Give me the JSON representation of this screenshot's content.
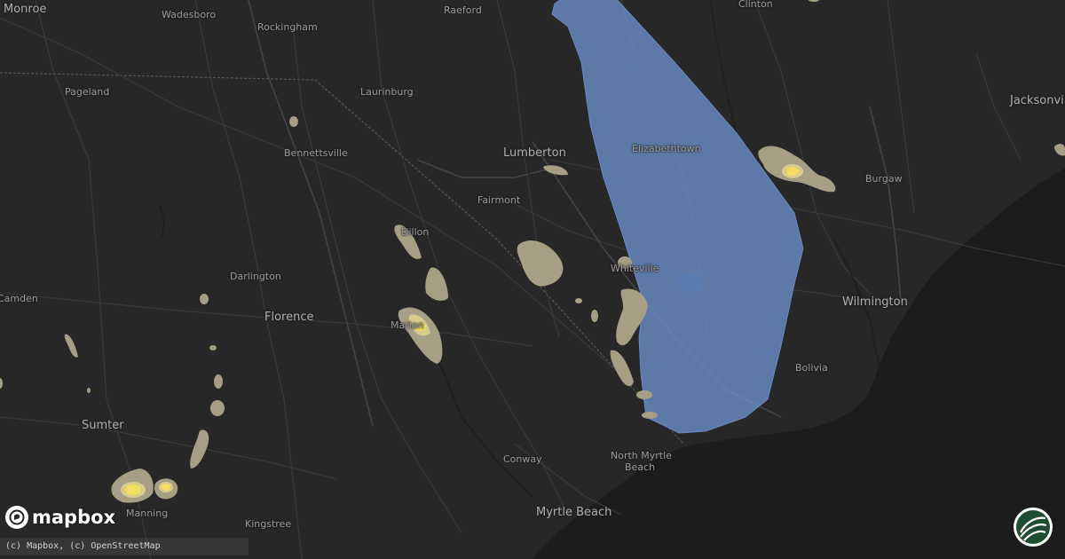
{
  "map": {
    "places": [
      {
        "id": "monroe",
        "name": "Monroe"
      },
      {
        "id": "wadesboro",
        "name": "Wadesboro"
      },
      {
        "id": "raeford",
        "name": "Raeford"
      },
      {
        "id": "clinton",
        "name": "Clinton"
      },
      {
        "id": "rockingham",
        "name": "Rockingham"
      },
      {
        "id": "pageland",
        "name": "Pageland"
      },
      {
        "id": "laurinburg",
        "name": "Laurinburg"
      },
      {
        "id": "jacksonville",
        "name": "Jacksonvil"
      },
      {
        "id": "bennettsville",
        "name": "Bennettsville"
      },
      {
        "id": "lumberton",
        "name": "Lumberton"
      },
      {
        "id": "elizabethtown",
        "name": "Elizabethtown"
      },
      {
        "id": "burgaw",
        "name": "Burgaw"
      },
      {
        "id": "fairmont",
        "name": "Fairmont"
      },
      {
        "id": "dillon",
        "name": "Dillon"
      },
      {
        "id": "whiteville",
        "name": "Whiteville"
      },
      {
        "id": "darlington",
        "name": "Darlington"
      },
      {
        "id": "camden",
        "name": "Camden"
      },
      {
        "id": "wilmington",
        "name": "Wilmington"
      },
      {
        "id": "florence",
        "name": "Florence"
      },
      {
        "id": "marion",
        "name": "Marion"
      },
      {
        "id": "bolivia",
        "name": "Bolivia"
      },
      {
        "id": "sumter",
        "name": "Sumter"
      },
      {
        "id": "conway",
        "name": "Conway"
      },
      {
        "id": "north-myrtle-beach-1",
        "name": "North Myrtle"
      },
      {
        "id": "north-myrtle-beach-2",
        "name": "Beach"
      },
      {
        "id": "manning",
        "name": "Manning"
      },
      {
        "id": "myrtle-beach",
        "name": "Myrtle Beach"
      },
      {
        "id": "kingstree",
        "name": "Kingstree"
      }
    ],
    "colors": {
      "land": "#272727",
      "water": "#1c1c1c",
      "alert_polygon": "#6b8fc9",
      "hail_light": "#a69f86",
      "hail_medium": "#d9cc8a",
      "hail_core": "#f2dd5e"
    }
  },
  "branding": {
    "logo_text": "mapbox",
    "logo_icon": "mapbox-logo-icon",
    "attribution": "(c) Mapbox, (c) OpenStreetMap",
    "badge_icon": "site-badge-icon"
  }
}
